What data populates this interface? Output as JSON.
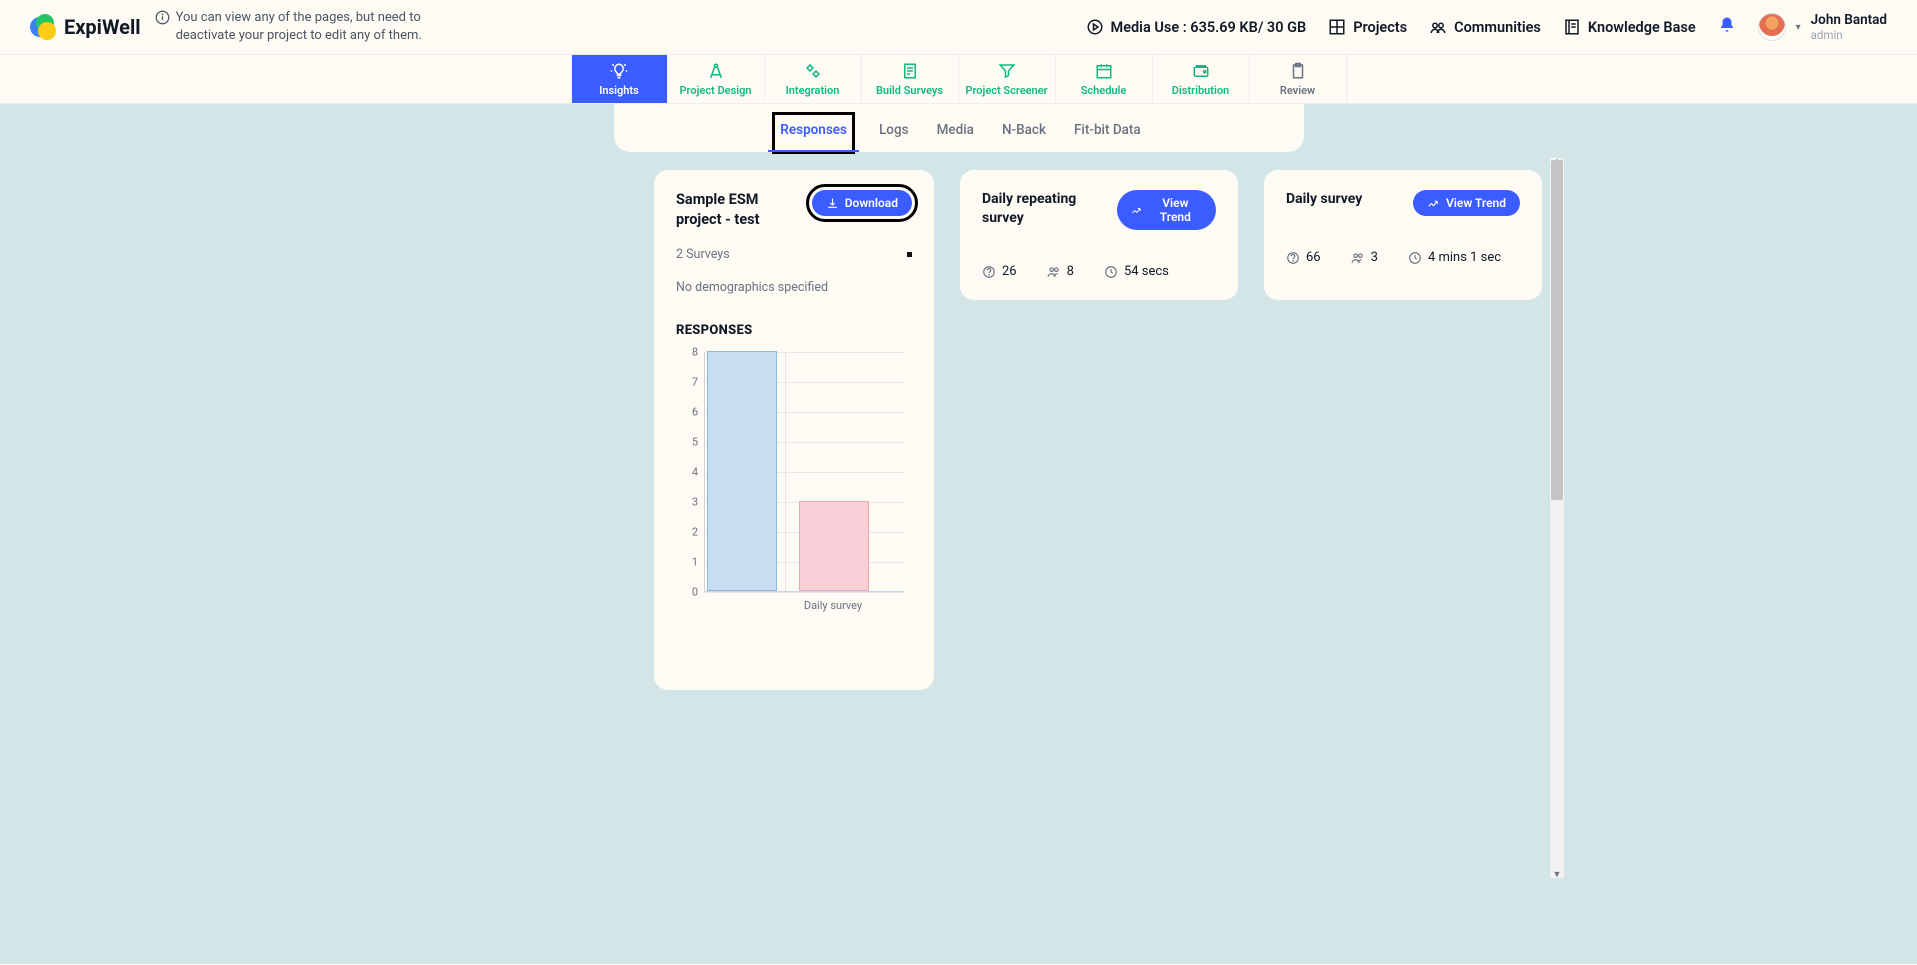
{
  "header": {
    "brand": "ExpiWell",
    "info_message": "You can view any of the pages, but need to deactivate your project to edit any of them.",
    "media_use": "Media Use : 635.69 KB/ 30 GB",
    "projects": "Projects",
    "communities": "Communities",
    "knowledge_base": "Knowledge Base",
    "user_name": "John Bantad",
    "user_role": "admin"
  },
  "mainnav": {
    "insights": "Insights",
    "project_design": "Project Design",
    "integration": "Integration",
    "build_surveys": "Build Surveys",
    "project_screener": "Project Screener",
    "schedule": "Schedule",
    "distribution": "Distribution",
    "review": "Review"
  },
  "subtabs": {
    "responses": "Responses",
    "logs": "Logs",
    "media": "Media",
    "nback": "N-Back",
    "fitbit": "Fit-bit Data"
  },
  "main_card": {
    "title": "Sample ESM project - test",
    "download": "Download",
    "surveys_count": "2 Surveys",
    "demographics": "No demographics specified",
    "responses_header": "RESPONSES"
  },
  "survey_cards": [
    {
      "title": "Daily repeating survey",
      "view_trend": "View Trend",
      "responses": "26",
      "participants": "8",
      "avg_time": "54 secs"
    },
    {
      "title": "Daily survey",
      "view_trend": "View Trend",
      "responses": "66",
      "participants": "3",
      "avg_time": "4 mins 1 sec"
    }
  ],
  "chart_data": {
    "type": "bar",
    "categories": [
      "Daily repeating survey",
      "Daily survey"
    ],
    "values": [
      8,
      3
    ],
    "title": "RESPONSES",
    "xlabel": "",
    "ylabel": "",
    "ylim": [
      0,
      8
    ],
    "y_ticks": [
      0,
      1,
      2,
      3,
      4,
      5,
      6,
      7,
      8
    ],
    "x_visible_labels": [
      "",
      "Daily survey"
    ],
    "colors": [
      "#c7ddf0",
      "#f7cfd6"
    ]
  }
}
